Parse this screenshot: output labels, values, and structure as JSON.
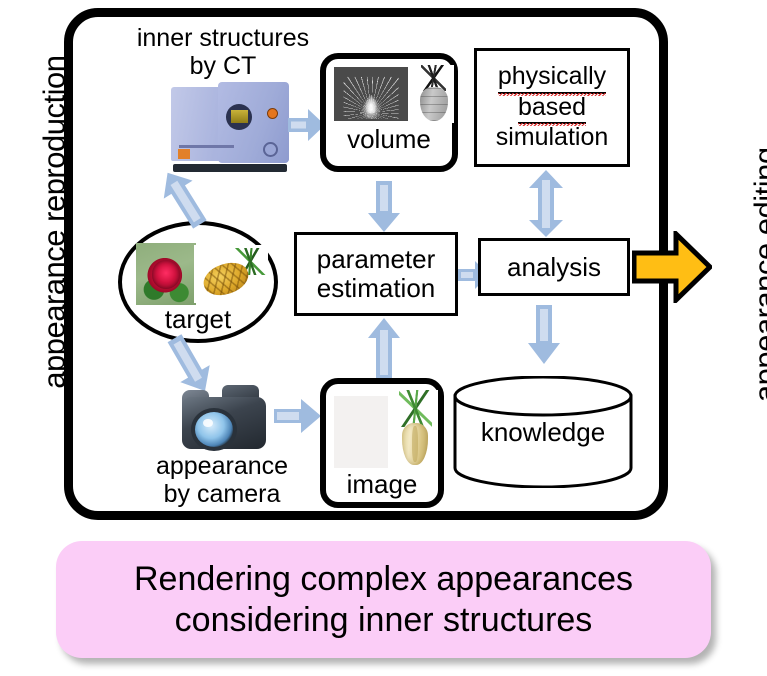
{
  "side_labels": {
    "left": "appearance reproduction",
    "right": "appearance editing"
  },
  "captions": {
    "ct": "inner structures\nby CT",
    "camera": "appearance\nby camera"
  },
  "nodes": {
    "volume": "volume",
    "simulation_line1": "physically",
    "simulation_line2": "based",
    "simulation_line3": "simulation",
    "parameter_estimation_line1": "parameter",
    "parameter_estimation_line2": "estimation",
    "analysis": "analysis",
    "target": "target",
    "image": "image",
    "knowledge": "knowledge"
  },
  "banner": {
    "text": "Rendering complex  appearances\nconsidering inner structures"
  },
  "colors": {
    "arrow_blue": "#9fbbdf",
    "arrow_blue_light": "#cfdcef",
    "accent_yellow": "#ffbe14",
    "banner_pink": "#fbcdf7",
    "frame_black": "#000000"
  },
  "icons": {
    "ct_scanner": "ct-scanner-icon",
    "camera": "camera-icon",
    "database": "database-cylinder-icon",
    "big_arrow": "yellow-right-arrow-icon"
  }
}
